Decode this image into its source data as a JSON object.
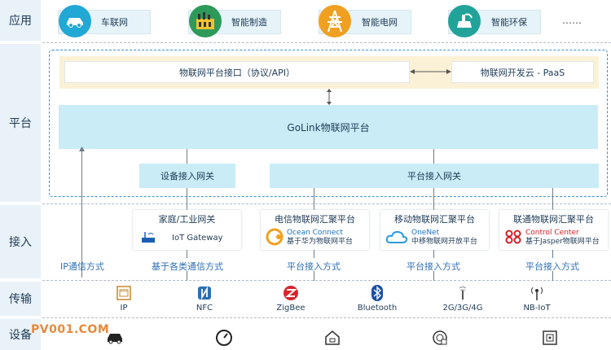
{
  "layers": {
    "app": "应用",
    "platform": "平台",
    "access": "接入",
    "transport": "传输",
    "device": "设备"
  },
  "apps": [
    {
      "label": "车联网",
      "icon": "car-icon",
      "color": "#22a8d4"
    },
    {
      "label": "智能制造",
      "icon": "factory-icon",
      "color": "#2e9a5a"
    },
    {
      "label": "智能电网",
      "icon": "power-tower-icon",
      "color": "#f0a020"
    },
    {
      "label": "智能环保",
      "icon": "eco-icon",
      "color": "#21a39a"
    }
  ],
  "apps_more": "……",
  "platform": {
    "api": "物联网平台接口（协议/API）",
    "paas": "物联网开发云 - PaaS",
    "golink": "GoLink物联网平台",
    "device_gw": "设备接入网关",
    "platform_gw": "平台接入网关"
  },
  "gateways": [
    {
      "title": "家庭/工业网关",
      "sub1": "IoT Gateway",
      "sub2": "",
      "logo": "router-icon"
    },
    {
      "title": "电信物联网汇聚平台",
      "sub1": "Ocean Connect",
      "sub2": "基于华为物联网平台",
      "logo": "ocean-connect-logo"
    },
    {
      "title": "移动物联网汇聚平台",
      "sub1": "OneNet",
      "sub2": "中移物联网开放平台",
      "logo": "cloud-icon"
    },
    {
      "title": "联通物联网汇聚平台",
      "sub1": "Control Center",
      "sub2": "基于Jasper物联网平台",
      "logo": "unicom-logo"
    }
  ],
  "access_methods": {
    "ip": "IP通信方式",
    "comm": "基于各类通信方式",
    "p1": "平台接入方式",
    "p2": "平台接入方式",
    "p3": "平台接入方式"
  },
  "transport": [
    {
      "label": "IP",
      "icon": "ethernet-port-icon"
    },
    {
      "label": "NFC",
      "icon": "nfc-icon"
    },
    {
      "label": "ZigBee",
      "icon": "zigbee-icon"
    },
    {
      "label": "Bluetooth",
      "icon": "bluetooth-icon"
    },
    {
      "label": "2G/3G/4G",
      "icon": "cellular-icon"
    },
    {
      "label": "NB-IoT",
      "icon": "antenna-icon"
    }
  ],
  "devices": [
    "car-icon",
    "gauge-icon",
    "smart-home-icon",
    "sensor-icon",
    "terminal-icon"
  ],
  "watermark": "PV001.COM",
  "colors": {
    "accent_blue": "#2f6fb5",
    "panel_light": "#c9ecf7",
    "layer_bg": "#e9f2f8",
    "dashed_border": "#3a8fd6",
    "api_bg": "#fbf1d6"
  }
}
